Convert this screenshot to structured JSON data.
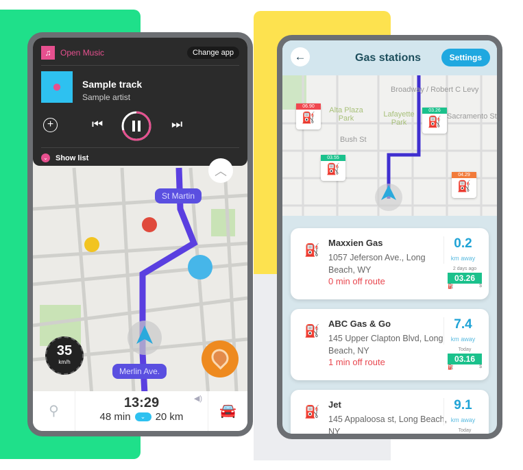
{
  "colors": {
    "green": "#1fe08a",
    "yellow": "#fde24f",
    "accent_pink": "#e6508f",
    "route": "#5a3fe0",
    "blue": "#1fa3d6"
  },
  "left_phone": {
    "music": {
      "app_name": "Open Music",
      "change_app": "Change app",
      "track": "Sample track",
      "artist": "Sample artist",
      "show_list": "Show list",
      "progress": 0.7
    },
    "map_labels": {
      "street1": "St Martin",
      "street2": "Merlin Ave."
    },
    "speed": {
      "value": "35",
      "unit": "km/h"
    },
    "bottom": {
      "eta": "13:29",
      "duration": "48 min",
      "distance": "20 km"
    }
  },
  "right_phone": {
    "title": "Gas stations",
    "settings": "Settings",
    "map_labels": [
      "Broadway / Robert C Levy",
      "Alta Plaza Park",
      "Lafayette Park",
      "Bush St",
      "Sacramento St"
    ],
    "map_prices": [
      {
        "price": "06.90",
        "color": "#f0474f"
      },
      {
        "price": "03.26",
        "color": "#1bc18c"
      },
      {
        "price": "03.55",
        "color": "#1bc18c"
      },
      {
        "price": "04.29",
        "color": "#f27b3a"
      }
    ],
    "stations": [
      {
        "name": "Maxxien Gas",
        "address": "1057 Jeferson Ave., Long Beach, WY",
        "off_route": "0 min off route",
        "distance": "0.2",
        "distance_unit": "km away",
        "updated": "2 days ago",
        "price": "03.26",
        "currency": "$"
      },
      {
        "name": "ABC Gas & Go",
        "address": "145 Upper Clapton Blvd, Long Beach, NY",
        "off_route": "1 min off route",
        "distance": "7.4",
        "distance_unit": "km away",
        "updated": "Today",
        "price": "03.16",
        "currency": "$"
      },
      {
        "name": "Jet",
        "address": "145 Appaloosa st, Long Beach, NY",
        "distance": "9.1",
        "distance_unit": "km away",
        "updated": "Today"
      }
    ]
  }
}
